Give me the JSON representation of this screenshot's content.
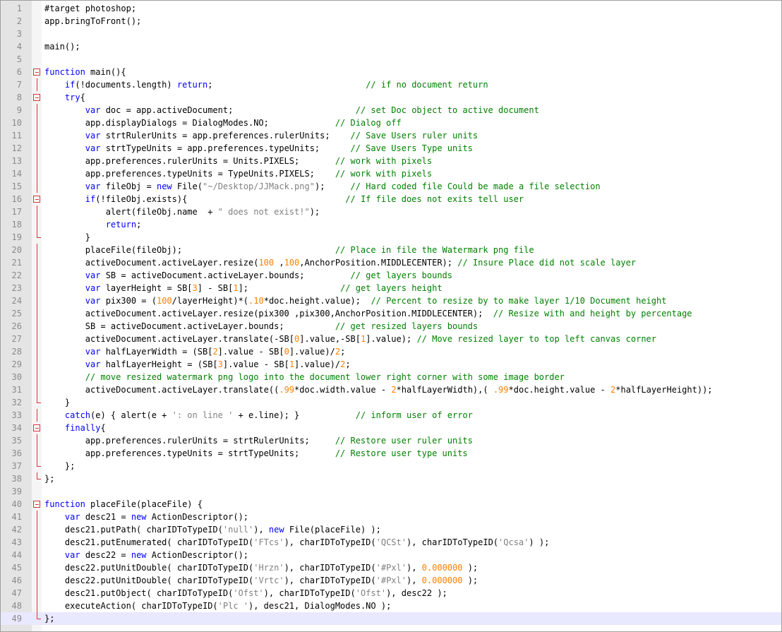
{
  "colors": {
    "keyword": "#0000ff",
    "string": "#808080",
    "number": "#ff8000",
    "comment": "#008000",
    "text": "#000000",
    "fold_marker": "#e0303a",
    "current_line": "#e8e8ff"
  },
  "current_line": 49,
  "lines": [
    {
      "n": "1",
      "fold": "",
      "tokens": [
        [
          "p",
          "#target photoshop;"
        ]
      ]
    },
    {
      "n": "2",
      "fold": "",
      "tokens": [
        [
          "p",
          "app.bringToFront();"
        ]
      ]
    },
    {
      "n": "3",
      "fold": "",
      "tokens": []
    },
    {
      "n": "4",
      "fold": "",
      "tokens": [
        [
          "p",
          "main();"
        ]
      ]
    },
    {
      "n": "5",
      "fold": "",
      "tokens": []
    },
    {
      "n": "6",
      "fold": "box",
      "tokens": [
        [
          "k",
          "function"
        ],
        [
          "p",
          " main(){"
        ]
      ]
    },
    {
      "n": "7",
      "fold": "vline",
      "tokens": [
        [
          "p",
          "    "
        ],
        [
          "k",
          "if"
        ],
        [
          "p",
          "(!documents.length) "
        ],
        [
          "k",
          "return"
        ],
        [
          "p",
          ";                              "
        ],
        [
          "c",
          "// if no document return"
        ]
      ]
    },
    {
      "n": "8",
      "fold": "box",
      "tokens": [
        [
          "p",
          "    "
        ],
        [
          "k",
          "try"
        ],
        [
          "p",
          "{"
        ]
      ]
    },
    {
      "n": "9",
      "fold": "vline",
      "tokens": [
        [
          "p",
          "        "
        ],
        [
          "k",
          "var"
        ],
        [
          "p",
          " doc = app.activeDocument;                        "
        ],
        [
          "c",
          "// set Doc object to active document"
        ]
      ]
    },
    {
      "n": "10",
      "fold": "vline",
      "tokens": [
        [
          "p",
          "        app.displayDialogs = DialogModes.NO;             "
        ],
        [
          "c",
          "// Dialog off"
        ]
      ]
    },
    {
      "n": "11",
      "fold": "vline",
      "tokens": [
        [
          "p",
          "        "
        ],
        [
          "k",
          "var"
        ],
        [
          "p",
          " strtRulerUnits = app.preferences.rulerUnits;    "
        ],
        [
          "c",
          "// Save Users ruler units"
        ]
      ]
    },
    {
      "n": "12",
      "fold": "vline",
      "tokens": [
        [
          "p",
          "        "
        ],
        [
          "k",
          "var"
        ],
        [
          "p",
          " strtTypeUnits = app.preferences.typeUnits;      "
        ],
        [
          "c",
          "// Save Users Type units"
        ]
      ]
    },
    {
      "n": "13",
      "fold": "vline",
      "tokens": [
        [
          "p",
          "        app.preferences.rulerUnits = Units.PIXELS;       "
        ],
        [
          "c",
          "// work with pixels"
        ]
      ]
    },
    {
      "n": "14",
      "fold": "vline",
      "tokens": [
        [
          "p",
          "        app.preferences.typeUnits = TypeUnits.PIXELS;    "
        ],
        [
          "c",
          "// work with pixels"
        ]
      ]
    },
    {
      "n": "15",
      "fold": "vline",
      "tokens": [
        [
          "p",
          "        "
        ],
        [
          "k",
          "var"
        ],
        [
          "p",
          " fileObj = "
        ],
        [
          "k",
          "new"
        ],
        [
          "p",
          " File("
        ],
        [
          "s",
          "\"~/Desktop/JJMack.png\""
        ],
        [
          "p",
          ");     "
        ],
        [
          "c",
          "// Hard coded file Could be made a file selection"
        ]
      ]
    },
    {
      "n": "16",
      "fold": "box",
      "tokens": [
        [
          "p",
          "        "
        ],
        [
          "k",
          "if"
        ],
        [
          "p",
          "(!fileObj.exists){                               "
        ],
        [
          "c",
          "// If file does not exits tell user"
        ]
      ]
    },
    {
      "n": "17",
      "fold": "vline",
      "tokens": [
        [
          "p",
          "            alert(fileObj.name  + "
        ],
        [
          "s",
          "\" does not exist!\""
        ],
        [
          "p",
          ");"
        ]
      ]
    },
    {
      "n": "18",
      "fold": "vline",
      "tokens": [
        [
          "p",
          "            "
        ],
        [
          "k",
          "return"
        ],
        [
          "p",
          ";"
        ]
      ]
    },
    {
      "n": "19",
      "fold": "end",
      "tokens": [
        [
          "p",
          "        }"
        ]
      ]
    },
    {
      "n": "20",
      "fold": "vline",
      "tokens": [
        [
          "p",
          "        placeFile(fileObj);                              "
        ],
        [
          "c",
          "// Place in file the Watermark png file"
        ]
      ]
    },
    {
      "n": "21",
      "fold": "vline",
      "tokens": [
        [
          "p",
          "        activeDocument.activeLayer.resize("
        ],
        [
          "n",
          "100"
        ],
        [
          "p",
          " ,"
        ],
        [
          "n",
          "100"
        ],
        [
          "p",
          ",AnchorPosition.MIDDLECENTER); "
        ],
        [
          "c",
          "// Insure Place did not scale layer"
        ]
      ]
    },
    {
      "n": "22",
      "fold": "vline",
      "tokens": [
        [
          "p",
          "        "
        ],
        [
          "k",
          "var"
        ],
        [
          "p",
          " SB = activeDocument.activeLayer.bounds;         "
        ],
        [
          "c",
          "// get layers bounds"
        ]
      ]
    },
    {
      "n": "23",
      "fold": "vline",
      "tokens": [
        [
          "p",
          "        "
        ],
        [
          "k",
          "var"
        ],
        [
          "p",
          " layerHeight = SB["
        ],
        [
          "n",
          "3"
        ],
        [
          "p",
          "] - SB["
        ],
        [
          "n",
          "1"
        ],
        [
          "p",
          "];                  "
        ],
        [
          "c",
          "// get layers height"
        ]
      ]
    },
    {
      "n": "24",
      "fold": "vline",
      "tokens": [
        [
          "p",
          "        "
        ],
        [
          "k",
          "var"
        ],
        [
          "p",
          " pix300 = ("
        ],
        [
          "n",
          "100"
        ],
        [
          "p",
          "/layerHeight)*("
        ],
        [
          "n",
          ".10"
        ],
        [
          "p",
          "*doc.height.value);  "
        ],
        [
          "c",
          "// Percent to resize by to make layer 1/10 Document height"
        ]
      ]
    },
    {
      "n": "25",
      "fold": "vline",
      "tokens": [
        [
          "p",
          "        activeDocument.activeLayer.resize(pix300 ,pix300,AnchorPosition.MIDDLECENTER);  "
        ],
        [
          "c",
          "// Resize with and height by percentage"
        ]
      ]
    },
    {
      "n": "26",
      "fold": "vline",
      "tokens": [
        [
          "p",
          "        SB = activeDocument.activeLayer.bounds;          "
        ],
        [
          "c",
          "// get resized layers bounds"
        ]
      ]
    },
    {
      "n": "27",
      "fold": "vline",
      "tokens": [
        [
          "p",
          "        activeDocument.activeLayer.translate(-SB["
        ],
        [
          "n",
          "0"
        ],
        [
          "p",
          "].value,-SB["
        ],
        [
          "n",
          "1"
        ],
        [
          "p",
          "].value); "
        ],
        [
          "c",
          "// Move resized layer to top left canvas corner"
        ]
      ]
    },
    {
      "n": "28",
      "fold": "vline",
      "tokens": [
        [
          "p",
          "        "
        ],
        [
          "k",
          "var"
        ],
        [
          "p",
          " halfLayerWidth = (SB["
        ],
        [
          "n",
          "2"
        ],
        [
          "p",
          "].value - SB["
        ],
        [
          "n",
          "0"
        ],
        [
          "p",
          "].value)/"
        ],
        [
          "n",
          "2"
        ],
        [
          "p",
          ";"
        ]
      ]
    },
    {
      "n": "29",
      "fold": "vline",
      "tokens": [
        [
          "p",
          "        "
        ],
        [
          "k",
          "var"
        ],
        [
          "p",
          " halfLayerHeight = (SB["
        ],
        [
          "n",
          "3"
        ],
        [
          "p",
          "].value - SB["
        ],
        [
          "n",
          "1"
        ],
        [
          "p",
          "].value)/"
        ],
        [
          "n",
          "2"
        ],
        [
          "p",
          ";"
        ]
      ]
    },
    {
      "n": "30",
      "fold": "vline",
      "tokens": [
        [
          "p",
          "        "
        ],
        [
          "c",
          "// move resized watermark png logo into the document lower right corner with some image border"
        ]
      ]
    },
    {
      "n": "31",
      "fold": "vline",
      "tokens": [
        [
          "p",
          "        activeDocument.activeLayer.translate(("
        ],
        [
          "n",
          ".99"
        ],
        [
          "p",
          "*doc.width.value - "
        ],
        [
          "n",
          "2"
        ],
        [
          "p",
          "*halfLayerWidth),( "
        ],
        [
          "n",
          ".99"
        ],
        [
          "p",
          "*doc.height.value - "
        ],
        [
          "n",
          "2"
        ],
        [
          "p",
          "*halfLayerHeight));"
        ]
      ]
    },
    {
      "n": "32",
      "fold": "end",
      "tokens": [
        [
          "p",
          "    }"
        ]
      ]
    },
    {
      "n": "33",
      "fold": "vline",
      "tokens": [
        [
          "p",
          "    "
        ],
        [
          "k",
          "catch"
        ],
        [
          "p",
          "(e) { alert(e + "
        ],
        [
          "s",
          "': on line '"
        ],
        [
          "p",
          " + e.line); }           "
        ],
        [
          "c",
          "// inform user of error"
        ]
      ]
    },
    {
      "n": "34",
      "fold": "box",
      "tokens": [
        [
          "p",
          "    "
        ],
        [
          "k",
          "finally"
        ],
        [
          "p",
          "{"
        ]
      ]
    },
    {
      "n": "35",
      "fold": "vline",
      "tokens": [
        [
          "p",
          "        app.preferences.rulerUnits = strtRulerUnits;     "
        ],
        [
          "c",
          "// Restore user ruler units"
        ]
      ]
    },
    {
      "n": "36",
      "fold": "vline",
      "tokens": [
        [
          "p",
          "        app.preferences.typeUnits = strtTypeUnits;       "
        ],
        [
          "c",
          "// Restore user type units"
        ]
      ]
    },
    {
      "n": "37",
      "fold": "end",
      "tokens": [
        [
          "p",
          "    };"
        ]
      ]
    },
    {
      "n": "38",
      "fold": "end",
      "tokens": [
        [
          "p",
          "};"
        ]
      ]
    },
    {
      "n": "39",
      "fold": "",
      "tokens": []
    },
    {
      "n": "40",
      "fold": "box",
      "tokens": [
        [
          "k",
          "function"
        ],
        [
          "p",
          " placeFile(placeFile) {"
        ]
      ]
    },
    {
      "n": "41",
      "fold": "vline",
      "tokens": [
        [
          "p",
          "    "
        ],
        [
          "k",
          "var"
        ],
        [
          "p",
          " desc21 = "
        ],
        [
          "k",
          "new"
        ],
        [
          "p",
          " ActionDescriptor();"
        ]
      ]
    },
    {
      "n": "42",
      "fold": "vline",
      "tokens": [
        [
          "p",
          "    desc21.putPath( charIDToTypeID("
        ],
        [
          "s",
          "'null'"
        ],
        [
          "p",
          "), "
        ],
        [
          "k",
          "new"
        ],
        [
          "p",
          " File(placeFile) );"
        ]
      ]
    },
    {
      "n": "43",
      "fold": "vline",
      "tokens": [
        [
          "p",
          "    desc21.putEnumerated( charIDToTypeID("
        ],
        [
          "s",
          "'FTcs'"
        ],
        [
          "p",
          "), charIDToTypeID("
        ],
        [
          "s",
          "'QCSt'"
        ],
        [
          "p",
          "), charIDToTypeID("
        ],
        [
          "s",
          "'Qcsa'"
        ],
        [
          "p",
          ") );"
        ]
      ]
    },
    {
      "n": "44",
      "fold": "vline",
      "tokens": [
        [
          "p",
          "    "
        ],
        [
          "k",
          "var"
        ],
        [
          "p",
          " desc22 = "
        ],
        [
          "k",
          "new"
        ],
        [
          "p",
          " ActionDescriptor();"
        ]
      ]
    },
    {
      "n": "45",
      "fold": "vline",
      "tokens": [
        [
          "p",
          "    desc22.putUnitDouble( charIDToTypeID("
        ],
        [
          "s",
          "'Hrzn'"
        ],
        [
          "p",
          "), charIDToTypeID("
        ],
        [
          "s",
          "'#Pxl'"
        ],
        [
          "p",
          "), "
        ],
        [
          "n",
          "0.000000"
        ],
        [
          "p",
          " );"
        ]
      ]
    },
    {
      "n": "46",
      "fold": "vline",
      "tokens": [
        [
          "p",
          "    desc22.putUnitDouble( charIDToTypeID("
        ],
        [
          "s",
          "'Vrtc'"
        ],
        [
          "p",
          "), charIDToTypeID("
        ],
        [
          "s",
          "'#Pxl'"
        ],
        [
          "p",
          "), "
        ],
        [
          "n",
          "0.000000"
        ],
        [
          "p",
          " );"
        ]
      ]
    },
    {
      "n": "47",
      "fold": "vline",
      "tokens": [
        [
          "p",
          "    desc21.putObject( charIDToTypeID("
        ],
        [
          "s",
          "'Ofst'"
        ],
        [
          "p",
          "), charIDToTypeID("
        ],
        [
          "s",
          "'Ofst'"
        ],
        [
          "p",
          "), desc22 );"
        ]
      ]
    },
    {
      "n": "48",
      "fold": "vline",
      "tokens": [
        [
          "p",
          "    executeAction( charIDToTypeID("
        ],
        [
          "s",
          "'Plc '"
        ],
        [
          "p",
          "), desc21, DialogModes.NO );"
        ]
      ]
    },
    {
      "n": "49",
      "fold": "end",
      "tokens": [
        [
          "p",
          "};"
        ]
      ]
    }
  ]
}
